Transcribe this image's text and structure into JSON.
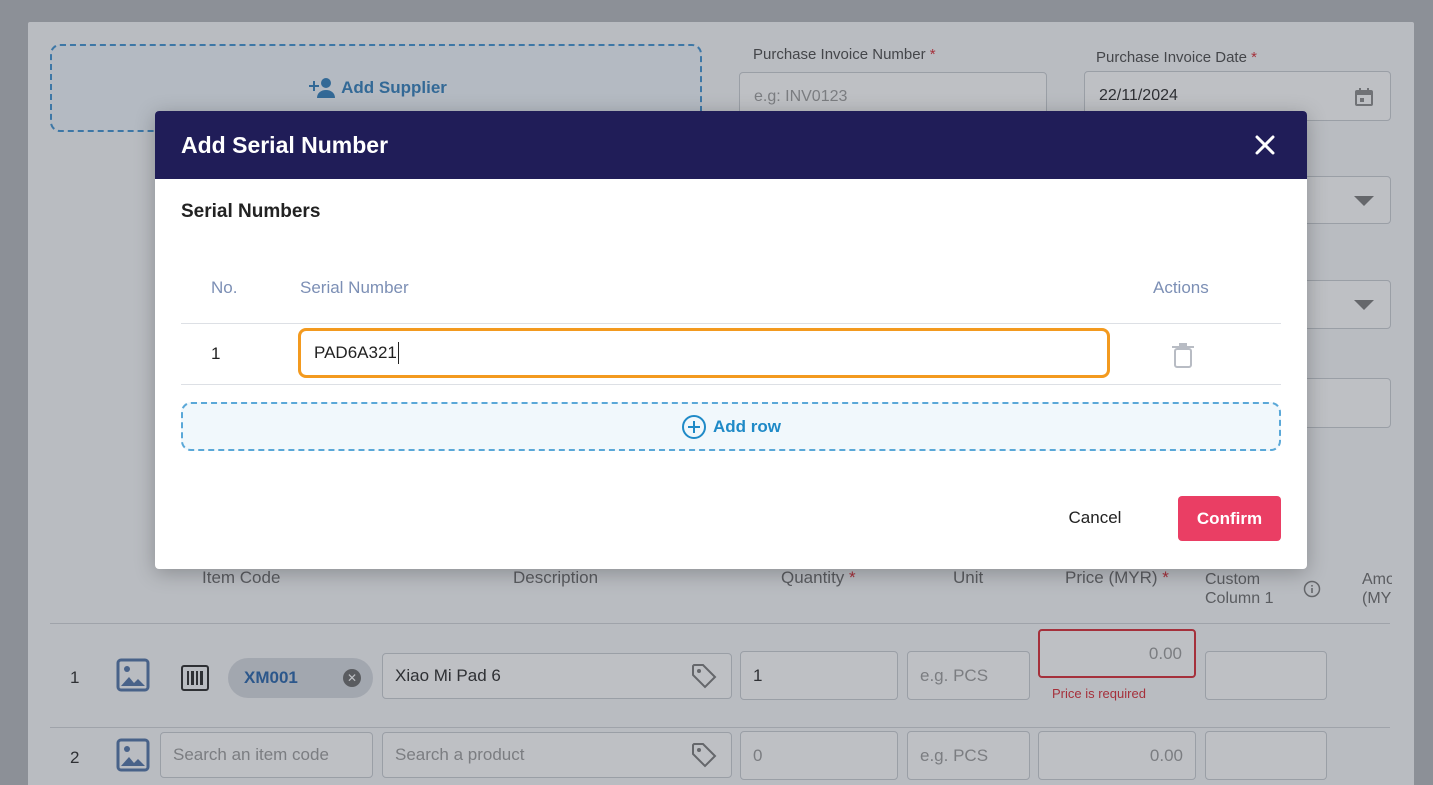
{
  "background": {
    "supplier": {
      "add_label": "Add Supplier"
    },
    "invoice_number": {
      "label": "Purchase Invoice Number",
      "required_mark": "*",
      "placeholder": "e.g: INV0123"
    },
    "invoice_date": {
      "label": "Purchase Invoice Date",
      "required_mark": "*",
      "value": "22/11/2024"
    },
    "table": {
      "headers": {
        "item_code": "Item Code",
        "description": "Description",
        "quantity": "Quantity",
        "quantity_req": "*",
        "unit": "Unit",
        "price": "Price (MYR)",
        "price_req": "*",
        "custom_col_line1": "Custom",
        "custom_col_line2": "Column 1",
        "amount_line1": "Amo",
        "amount_line2": "(MY"
      },
      "rows": [
        {
          "num": "1",
          "item_code": "XM001",
          "description": "Xiao Mi Pad 6",
          "quantity": "1",
          "unit_placeholder": "e.g. PCS",
          "price": "0.00",
          "price_error": "Price is required"
        },
        {
          "num": "2",
          "item_code_placeholder": "Search an item code",
          "description_placeholder": "Search a product",
          "quantity": "0",
          "unit_placeholder": "e.g. PCS",
          "price": "0.00"
        }
      ]
    }
  },
  "modal": {
    "title": "Add Serial Number",
    "section_title": "Serial Numbers",
    "columns": {
      "no": "No.",
      "serial": "Serial Number",
      "actions": "Actions"
    },
    "rows": [
      {
        "no": "1",
        "serial": "PAD6A321"
      }
    ],
    "add_row_label": "Add row",
    "cancel_label": "Cancel",
    "confirm_label": "Confirm",
    "colors": {
      "header_bg": "#201d58",
      "confirm_bg": "#ea3e64",
      "focus_border": "#f39a1f",
      "accent": "#1f8ac7"
    }
  }
}
